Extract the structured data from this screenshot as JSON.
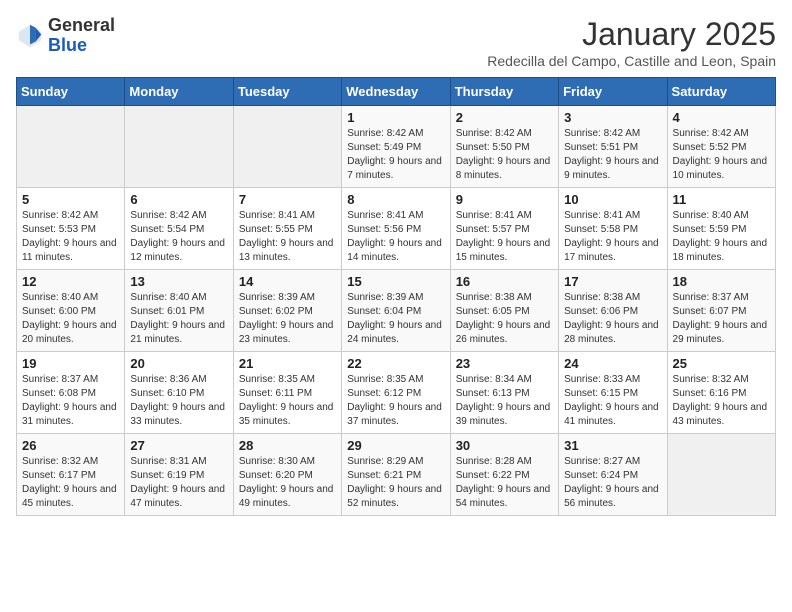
{
  "header": {
    "logo_general": "General",
    "logo_blue": "Blue",
    "title": "January 2025",
    "subtitle": "Redecilla del Campo, Castille and Leon, Spain"
  },
  "days_of_week": [
    "Sunday",
    "Monday",
    "Tuesday",
    "Wednesday",
    "Thursday",
    "Friday",
    "Saturday"
  ],
  "weeks": [
    {
      "days": [
        {
          "number": "",
          "empty": true
        },
        {
          "number": "",
          "empty": true
        },
        {
          "number": "",
          "empty": true
        },
        {
          "number": "1",
          "sunrise": "8:42 AM",
          "sunset": "5:49 PM",
          "daylight": "9 hours and 7 minutes."
        },
        {
          "number": "2",
          "sunrise": "8:42 AM",
          "sunset": "5:50 PM",
          "daylight": "9 hours and 8 minutes."
        },
        {
          "number": "3",
          "sunrise": "8:42 AM",
          "sunset": "5:51 PM",
          "daylight": "9 hours and 9 minutes."
        },
        {
          "number": "4",
          "sunrise": "8:42 AM",
          "sunset": "5:52 PM",
          "daylight": "9 hours and 10 minutes."
        }
      ]
    },
    {
      "days": [
        {
          "number": "5",
          "sunrise": "8:42 AM",
          "sunset": "5:53 PM",
          "daylight": "9 hours and 11 minutes."
        },
        {
          "number": "6",
          "sunrise": "8:42 AM",
          "sunset": "5:54 PM",
          "daylight": "9 hours and 12 minutes."
        },
        {
          "number": "7",
          "sunrise": "8:41 AM",
          "sunset": "5:55 PM",
          "daylight": "9 hours and 13 minutes."
        },
        {
          "number": "8",
          "sunrise": "8:41 AM",
          "sunset": "5:56 PM",
          "daylight": "9 hours and 14 minutes."
        },
        {
          "number": "9",
          "sunrise": "8:41 AM",
          "sunset": "5:57 PM",
          "daylight": "9 hours and 15 minutes."
        },
        {
          "number": "10",
          "sunrise": "8:41 AM",
          "sunset": "5:58 PM",
          "daylight": "9 hours and 17 minutes."
        },
        {
          "number": "11",
          "sunrise": "8:40 AM",
          "sunset": "5:59 PM",
          "daylight": "9 hours and 18 minutes."
        }
      ]
    },
    {
      "days": [
        {
          "number": "12",
          "sunrise": "8:40 AM",
          "sunset": "6:00 PM",
          "daylight": "9 hours and 20 minutes."
        },
        {
          "number": "13",
          "sunrise": "8:40 AM",
          "sunset": "6:01 PM",
          "daylight": "9 hours and 21 minutes."
        },
        {
          "number": "14",
          "sunrise": "8:39 AM",
          "sunset": "6:02 PM",
          "daylight": "9 hours and 23 minutes."
        },
        {
          "number": "15",
          "sunrise": "8:39 AM",
          "sunset": "6:04 PM",
          "daylight": "9 hours and 24 minutes."
        },
        {
          "number": "16",
          "sunrise": "8:38 AM",
          "sunset": "6:05 PM",
          "daylight": "9 hours and 26 minutes."
        },
        {
          "number": "17",
          "sunrise": "8:38 AM",
          "sunset": "6:06 PM",
          "daylight": "9 hours and 28 minutes."
        },
        {
          "number": "18",
          "sunrise": "8:37 AM",
          "sunset": "6:07 PM",
          "daylight": "9 hours and 29 minutes."
        }
      ]
    },
    {
      "days": [
        {
          "number": "19",
          "sunrise": "8:37 AM",
          "sunset": "6:08 PM",
          "daylight": "9 hours and 31 minutes."
        },
        {
          "number": "20",
          "sunrise": "8:36 AM",
          "sunset": "6:10 PM",
          "daylight": "9 hours and 33 minutes."
        },
        {
          "number": "21",
          "sunrise": "8:35 AM",
          "sunset": "6:11 PM",
          "daylight": "9 hours and 35 minutes."
        },
        {
          "number": "22",
          "sunrise": "8:35 AM",
          "sunset": "6:12 PM",
          "daylight": "9 hours and 37 minutes."
        },
        {
          "number": "23",
          "sunrise": "8:34 AM",
          "sunset": "6:13 PM",
          "daylight": "9 hours and 39 minutes."
        },
        {
          "number": "24",
          "sunrise": "8:33 AM",
          "sunset": "6:15 PM",
          "daylight": "9 hours and 41 minutes."
        },
        {
          "number": "25",
          "sunrise": "8:32 AM",
          "sunset": "6:16 PM",
          "daylight": "9 hours and 43 minutes."
        }
      ]
    },
    {
      "days": [
        {
          "number": "26",
          "sunrise": "8:32 AM",
          "sunset": "6:17 PM",
          "daylight": "9 hours and 45 minutes."
        },
        {
          "number": "27",
          "sunrise": "8:31 AM",
          "sunset": "6:19 PM",
          "daylight": "9 hours and 47 minutes."
        },
        {
          "number": "28",
          "sunrise": "8:30 AM",
          "sunset": "6:20 PM",
          "daylight": "9 hours and 49 minutes."
        },
        {
          "number": "29",
          "sunrise": "8:29 AM",
          "sunset": "6:21 PM",
          "daylight": "9 hours and 52 minutes."
        },
        {
          "number": "30",
          "sunrise": "8:28 AM",
          "sunset": "6:22 PM",
          "daylight": "9 hours and 54 minutes."
        },
        {
          "number": "31",
          "sunrise": "8:27 AM",
          "sunset": "6:24 PM",
          "daylight": "9 hours and 56 minutes."
        },
        {
          "number": "",
          "empty": true
        }
      ]
    }
  ]
}
